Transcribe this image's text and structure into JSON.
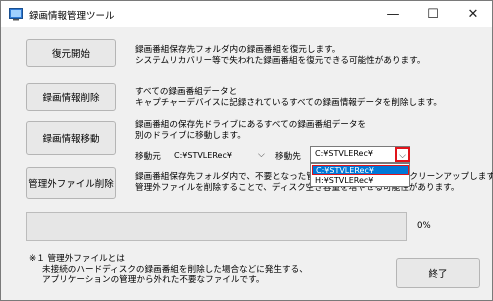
{
  "window": {
    "title": "録画情報管理ツール",
    "minimize_glyph": "—",
    "maximize_glyph": "☐",
    "close_glyph": "✕"
  },
  "buttons": {
    "restore": "復元開始",
    "delete_info": "録画情報削除",
    "move": "録画情報移動",
    "delete_unmanaged": "管理外ファイル削除",
    "end": "終了"
  },
  "descriptions": {
    "restore": [
      "録画番組保存先フォルダ内の録画番組を復元します。",
      "システムリカバリー等で失われた録画番組を復元できる可能性があります。"
    ],
    "delete_info": [
      "すべての録画番組データと",
      "キャプチャーデバイスに記録されているすべての録画情報データを削除します。"
    ],
    "move": [
      "録画番組の保存先ドライブにあるすべての録画番組データを",
      "別のドライブに移動します。"
    ],
    "unmanaged": [
      "録画番組保存先フォルダ内で、不要となった管理外のファイルを削除しクリーンアップします。",
      "管理外ファイルを削除することで、ディスク空き容量を増やせる可能性があります。"
    ]
  },
  "move": {
    "source_label": "移動元",
    "source_value": "C:¥STVLERec¥",
    "dest_label": "移動先",
    "dest_value": "C:¥STVLERec¥",
    "dest_options": [
      "C:¥STVLERec¥",
      "H:¥STVLERec¥"
    ],
    "arrow_glyph": "⌵"
  },
  "progress": {
    "percent_text": "0%",
    "value": 0,
    "fill_color": "#06b025"
  },
  "note": {
    "line1": "※１ 管理外ファイルとは",
    "line2": "未接続のハードディスクの録画番組を削除した場合などに発生する、",
    "line3": "アプリケーションの管理から外れた不要なファイルです。"
  },
  "colors": {
    "highlight": "#e0141b",
    "selection": "#0078d7"
  }
}
